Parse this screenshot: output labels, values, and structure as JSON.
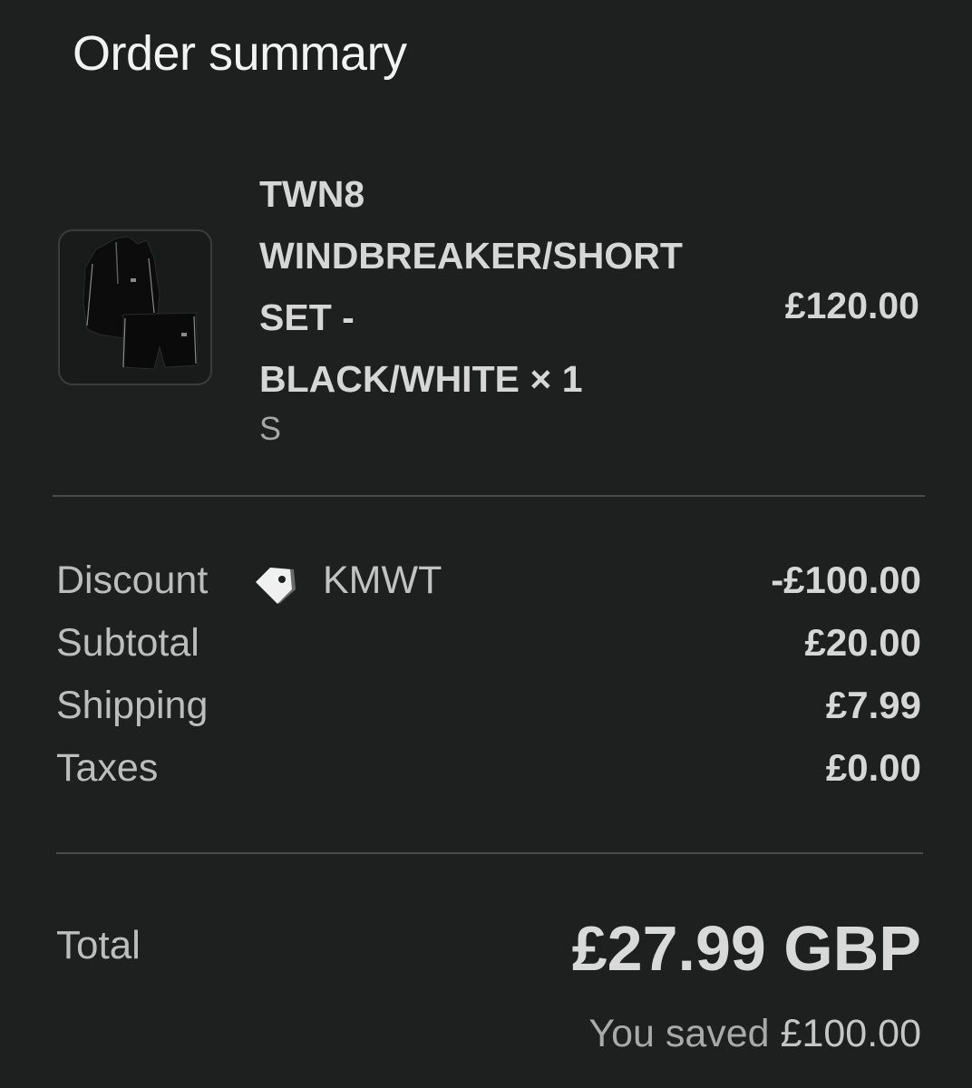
{
  "header": {
    "title": "Order summary"
  },
  "line_item": {
    "name": "TWN8 WINDBREAKER/SHORT SET - BLACK/WHITE",
    "name_lines": [
      "TWN8",
      "WINDBREAKER/SHORT",
      "SET -",
      "BLACK/WHITE"
    ],
    "quantity_text": "× 1",
    "variant": "S",
    "price": "£120.00",
    "image_icon": "tracksuit-thumbnail"
  },
  "summary": {
    "discount": {
      "label": "Discount",
      "code": "KMWT",
      "icon": "tag-icon",
      "value": "-£100.00"
    },
    "subtotal": {
      "label": "Subtotal",
      "value": "£20.00"
    },
    "shipping": {
      "label": "Shipping",
      "value": "£7.99"
    },
    "taxes": {
      "label": "Taxes",
      "value": "£0.00"
    }
  },
  "total": {
    "label": "Total",
    "value": "£27.99 GBP",
    "saved_prefix": "You saved",
    "saved_amount": "£100.00"
  },
  "colors": {
    "background": "#1e1f1f",
    "text_primary": "#d6d6d6",
    "text_secondary": "#a6a6a6",
    "divider": "#4a4b4b"
  }
}
